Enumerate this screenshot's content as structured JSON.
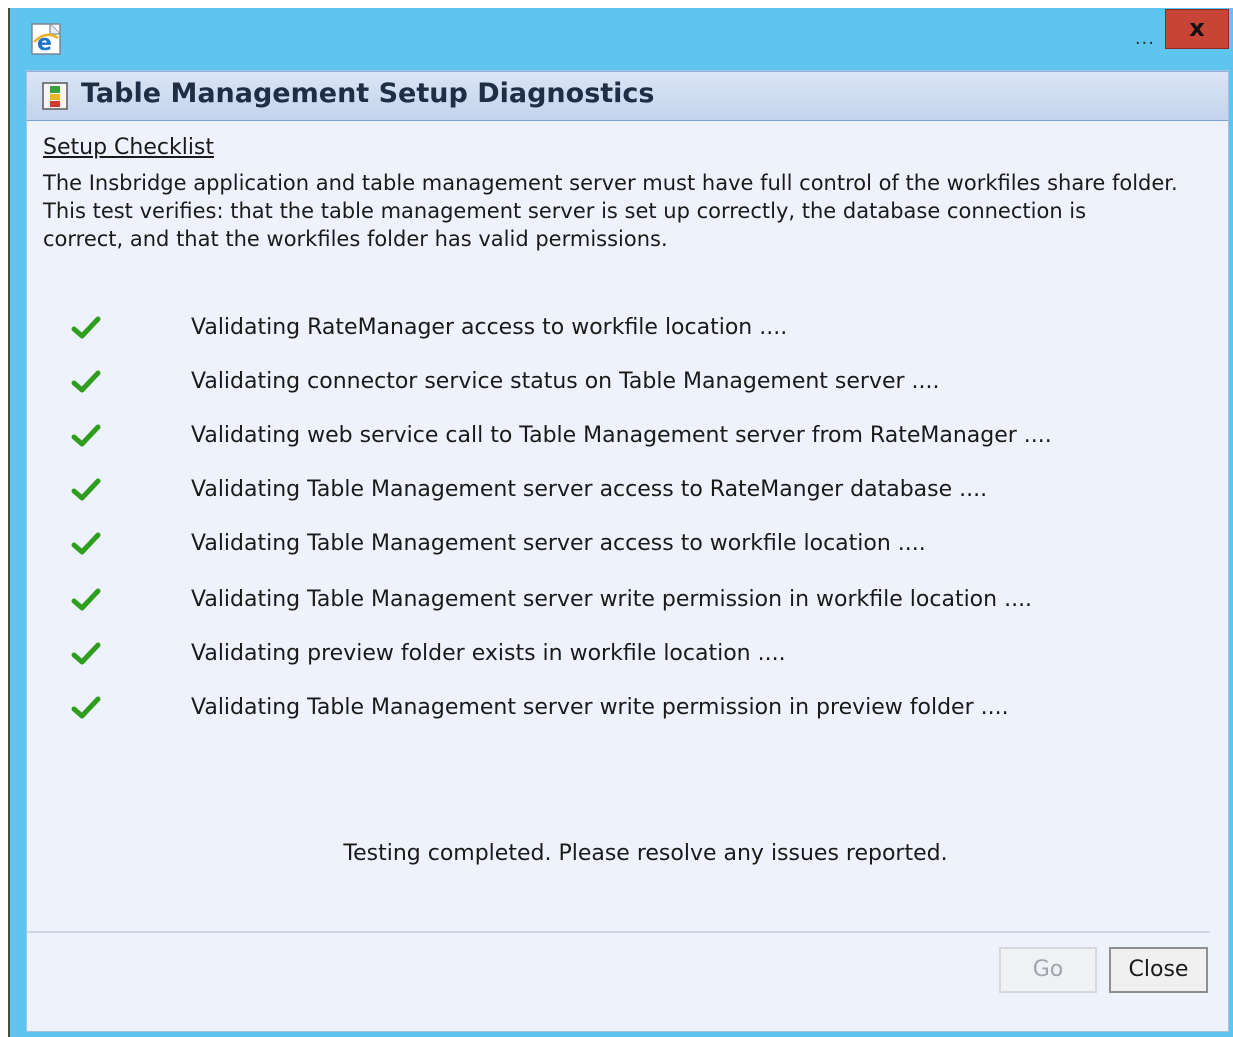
{
  "window": {
    "overflow_indicator": "...",
    "close_button": "x",
    "app_icon": "ie-icon"
  },
  "dialog": {
    "title": "Table Management Setup Diagnostics",
    "title_icon": "diagnostics-icon",
    "checklist_title": "Setup Checklist",
    "description_lines": [
      "The Insbridge application and table management server must have full control of the workfiles share folder.",
      "This test verifies: that the table management server is set up correctly, the database connection is",
      "correct, and that the workfiles folder has valid permissions."
    ],
    "checks": [
      {
        "label": "Validating RateManager access to workfile location ....",
        "status": "passed"
      },
      {
        "label": "Validating connector service status on Table Management server ....",
        "status": "passed"
      },
      {
        "label": "Validating web service call to Table Management server from RateManager ....",
        "status": "passed"
      },
      {
        "label": "Validating Table Management server access to RateManger database ....",
        "status": "passed"
      },
      {
        "label": "Validating Table Management server access to workfile location ....",
        "status": "passed"
      },
      {
        "label": "Validating Table Management server write permission in workfile location ....",
        "status": "passed"
      },
      {
        "label": "Validating preview folder exists in workfile location ....",
        "status": "passed"
      },
      {
        "label": "Validating Table Management server write permission in preview folder ....",
        "status": "passed"
      }
    ],
    "status_message": "Testing completed. Please resolve any issues reported.",
    "buttons": {
      "go": "Go",
      "close": "Close"
    }
  },
  "colors": {
    "window_frame": "#5ec5ee",
    "close_button": "#c84437",
    "dialog_background": "#eef2fc",
    "check_green": "#2f9e1f"
  }
}
